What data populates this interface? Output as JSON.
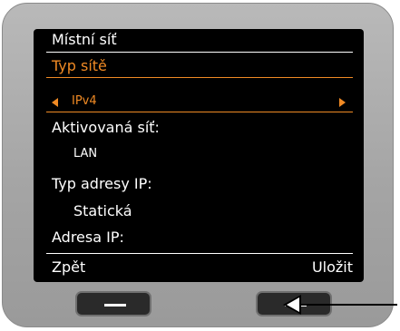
{
  "screen": {
    "title": "Místní síť",
    "field_label": "Typ sítě",
    "selected_value": "IPv4",
    "active_net_label": "Aktivovaná síť:",
    "active_net_value": "LAN",
    "ip_type_label": "Typ adresy IP:",
    "ip_type_value": "Statická",
    "ip_address_label": "Adresa IP:"
  },
  "softkeys": {
    "left": "Zpět",
    "right": "Uložit"
  },
  "colors": {
    "accent": "#f08a24",
    "screen_bg": "#000000",
    "bezel": "#a8a8a8"
  },
  "icons": [
    "left-arrow-icon",
    "right-arrow-icon",
    "pointer-arrow-icon"
  ]
}
